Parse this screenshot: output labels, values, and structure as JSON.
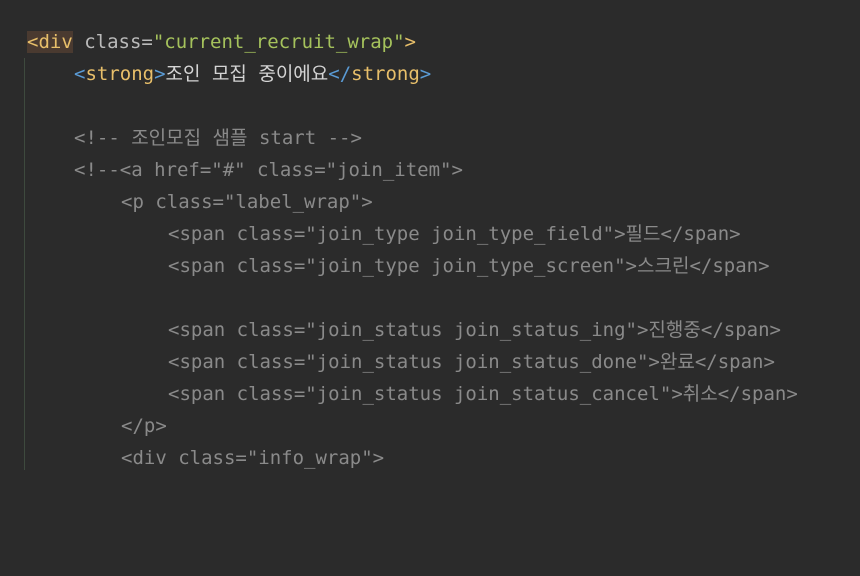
{
  "code": {
    "line1": {
      "open": "<",
      "tag": "div",
      "attr": " class=",
      "value": "\"current_recruit_wrap\"",
      "close": ">"
    },
    "line2": {
      "open": "<",
      "tag": "strong",
      "close": ">",
      "text": "조인 모집 중이에요",
      "end_open": "</",
      "end_tag": "strong",
      "end_close": ">"
    },
    "line3": "<!-- 조인모집 샘플 start -->",
    "line4": "<!--<a href=\"#\" class=\"join_item\">",
    "line5": "<p class=\"label_wrap\">",
    "line6": "<span class=\"join_type join_type_field\">필드</span>",
    "line7": "<span class=\"join_type join_type_screen\">스크린</span>",
    "line8": "<span class=\"join_status join_status_ing\">진행중</span>",
    "line9": "<span class=\"join_status join_status_done\">완료</span>",
    "line10": "<span class=\"join_status join_status_cancel\">취소</span>",
    "line11": "</p>",
    "line12": "<div class=\"info_wrap\">"
  },
  "colors": {
    "background": "#2b2b2b",
    "tag": "#e8bf6a",
    "string": "#a5c25c",
    "comment": "#8a8a8a",
    "strong_bracket": "#5a9bd5"
  }
}
